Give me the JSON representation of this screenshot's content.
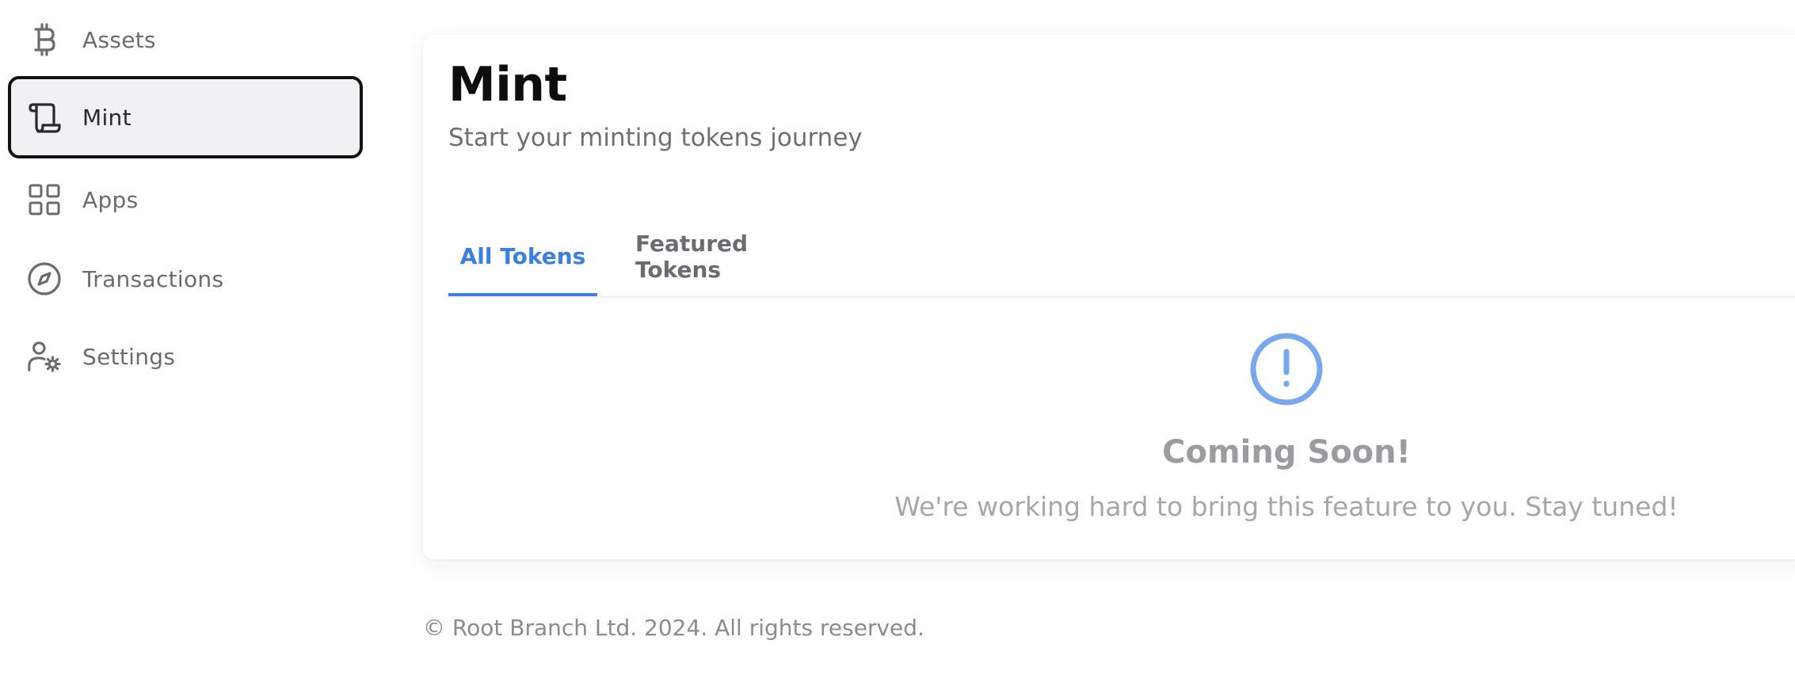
{
  "sidebar": {
    "items": [
      {
        "label": "Assets",
        "icon": "bitcoin-icon",
        "active": false
      },
      {
        "label": "Mint",
        "icon": "scroll-icon",
        "active": true
      },
      {
        "label": "Apps",
        "icon": "apps-grid-icon",
        "active": false
      },
      {
        "label": "Transactions",
        "icon": "compass-icon",
        "active": false
      },
      {
        "label": "Settings",
        "icon": "user-settings-icon",
        "active": false
      }
    ]
  },
  "main": {
    "title": "Mint",
    "subtitle": "Start your minting tokens journey",
    "tabs": [
      {
        "label": "All Tokens",
        "active": true
      },
      {
        "label": "Featured Tokens",
        "active": false
      }
    ],
    "empty_state": {
      "icon": "alert-circle-icon",
      "title": "Coming Soon!",
      "message": "We're working hard to bring this feature to you. Stay tuned!"
    }
  },
  "footer": {
    "text": "© Root Branch Ltd. 2024. All rights reserved."
  },
  "colors": {
    "accent": "#3b7fe0",
    "alert_icon": "#7aa8ee",
    "active_border": "#121212",
    "active_bg": "#f1f1f3"
  }
}
